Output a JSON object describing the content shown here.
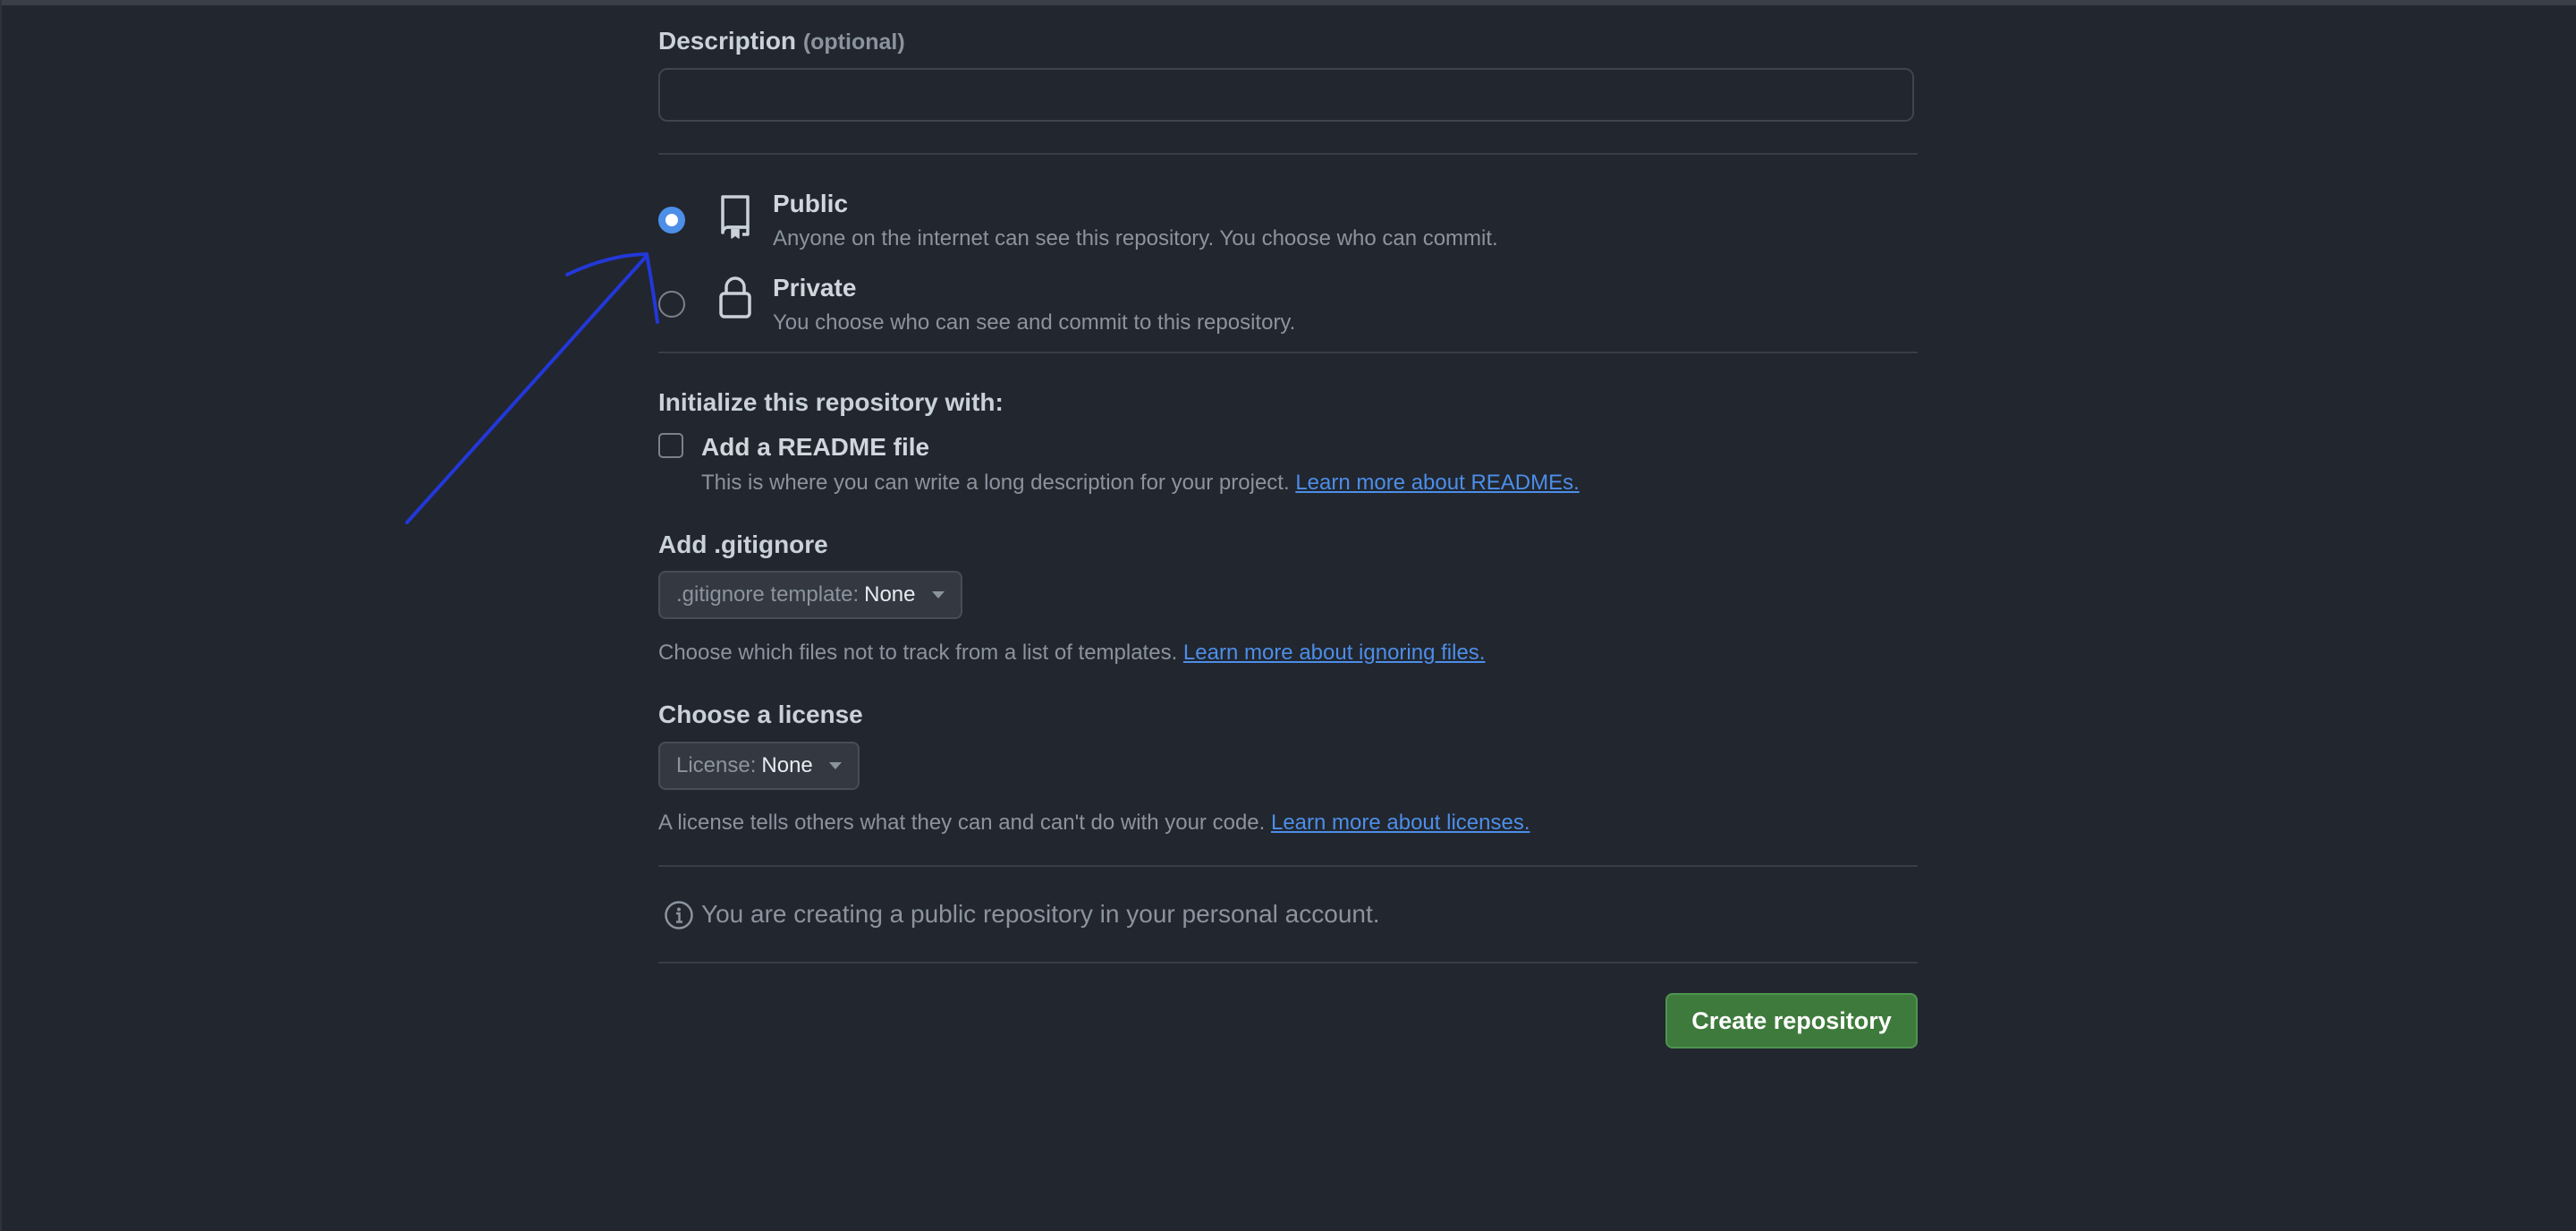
{
  "description": {
    "label": "Description",
    "optional_hint": "(optional)",
    "value": ""
  },
  "visibility": {
    "selected": "public",
    "public": {
      "title": "Public",
      "description": "Anyone on the internet can see this repository. You choose who can commit."
    },
    "private": {
      "title": "Private",
      "description": "You choose who can see and commit to this repository."
    }
  },
  "initialize": {
    "heading": "Initialize this repository with:",
    "readme": {
      "label": "Add a README file",
      "checked": false,
      "description": "This is where you can write a long description for your project.",
      "link": "Learn more about READMEs."
    }
  },
  "gitignore": {
    "heading": "Add .gitignore",
    "select_prefix": ".gitignore template:",
    "select_value": "None",
    "help": "Choose which files not to track from a list of templates.",
    "link": "Learn more about ignoring files."
  },
  "license": {
    "heading": "Choose a license",
    "select_prefix": "License:",
    "select_value": "None",
    "help": "A license tells others what they can and can't do with your code.",
    "link": "Learn more about licenses."
  },
  "notice": {
    "text": "You are creating a public repository in your personal account."
  },
  "create_button": {
    "label": "Create repository"
  },
  "colors": {
    "background": "#22262e",
    "link": "#4c8ee8",
    "primary_button": "#3e7a3c",
    "annotation_arrow": "#2238d8"
  },
  "icons": {
    "public": "repo-icon",
    "private": "lock-icon",
    "notice": "info-icon",
    "dropdown": "caret-down-icon"
  }
}
